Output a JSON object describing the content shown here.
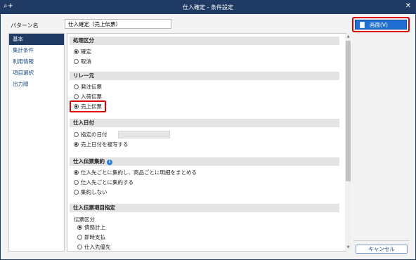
{
  "window": {
    "title": "仕入確定 - 条件設定",
    "app_icon": "search-plus-icon",
    "close_icon": "close-icon"
  },
  "pattern": {
    "label": "パターン名",
    "value": "仕入確定（売上伝票）"
  },
  "sidebar": {
    "items": [
      {
        "label": "基本",
        "active": true
      },
      {
        "label": "集計条件",
        "active": false
      },
      {
        "label": "利用情報",
        "active": false
      },
      {
        "label": "項目選択",
        "active": false
      },
      {
        "label": "出力順",
        "active": false
      }
    ]
  },
  "sections": {
    "shori": {
      "title": "処理区分",
      "options": [
        {
          "label": "確定",
          "selected": true
        },
        {
          "label": "取消",
          "selected": false
        }
      ]
    },
    "relay": {
      "title": "リレー元",
      "options": [
        {
          "label": "発注伝票",
          "selected": false
        },
        {
          "label": "入荷伝票",
          "selected": false
        },
        {
          "label": "売上伝票",
          "selected": true
        }
      ]
    },
    "date": {
      "title": "仕入日付",
      "options": [
        {
          "label": "指定の日付",
          "selected": false
        },
        {
          "label": "売上日付を複写する",
          "selected": true
        }
      ]
    },
    "shuyaku": {
      "title": "仕入伝票集約",
      "info_icon": "info-icon",
      "info_glyph": "i",
      "options": [
        {
          "label": "仕入先ごとに集約し、商品ごとに明細をまとめる",
          "selected": true
        },
        {
          "label": "仕入先ごとに集約する",
          "selected": false
        },
        {
          "label": "集約しない",
          "selected": false
        }
      ]
    },
    "komoku": {
      "title": "仕入伝票項目指定",
      "sub_label": "伝票区分",
      "options": [
        {
          "label": "債務計上",
          "selected": true
        },
        {
          "label": "即時支払",
          "selected": false
        },
        {
          "label": "仕入先優先",
          "selected": false
        }
      ]
    }
  },
  "buttons": {
    "print": "画面(V)",
    "cancel": "キャンセル"
  },
  "colors": {
    "titlebar": "#1f3b64",
    "accent": "#1f6fd2",
    "highlight": "#e00000"
  }
}
